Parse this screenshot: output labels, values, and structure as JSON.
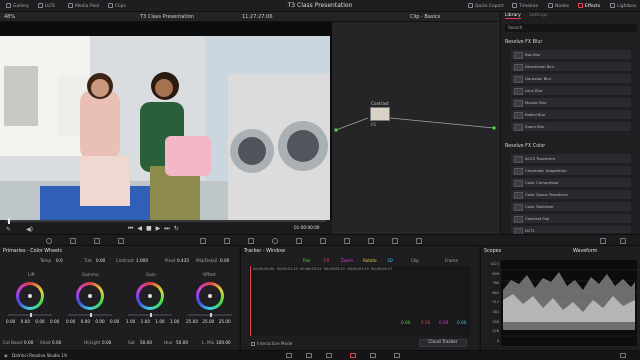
{
  "app": {
    "project_title": "T3 Class Presentation",
    "version": "DaVinci Resolve Studio 19"
  },
  "top_nav": {
    "left": [
      "Gallery",
      "LUTs",
      "Media Pool",
      "Clips"
    ],
    "right": [
      "Quick Export",
      "Timeline",
      "Nodes",
      "Effects",
      "Lightbox"
    ]
  },
  "viewer": {
    "zoom": "48%",
    "title": "T3 Class Presentation",
    "timecode": "11:27:27:06",
    "node_panel_title": "Clip - Basics",
    "playhead_timecode": "01:00:00:00"
  },
  "node_graph": {
    "node_label": "Contrast",
    "node_number": "01"
  },
  "library": {
    "tabs": [
      "Library",
      "Settings"
    ],
    "search_placeholder": "Search",
    "sections": [
      {
        "title": "Resolve FX Blur",
        "items": [
          "Box Blur",
          "Directional Blur",
          "Gaussian Blur",
          "Lens Blur",
          "Mosaic Blur",
          "Radial Blur",
          "Zoom Blur"
        ]
      },
      {
        "title": "Resolve FX Color",
        "items": [
          "ACES Transform",
          "Chromatic Adaptation",
          "Color Compressor",
          "Color Space Transform",
          "Color Stabilizer",
          "Contrast Pop",
          "DCTL"
        ]
      }
    ]
  },
  "color_wheels": {
    "title": "Primaries - Color Wheels",
    "temp_label": "Temp",
    "temp": "0.0",
    "tint_label": "Tint",
    "tint": "0.00",
    "contrast_label": "Contrast",
    "contrast": "1.000",
    "pivot_label": "Pivot",
    "pivot": "0.435",
    "middetail_label": "Mid/Detail",
    "middetail": "0.00",
    "wheels": [
      {
        "name": "Lift",
        "values": [
          "0.00",
          "0.00",
          "0.00",
          "0.00"
        ]
      },
      {
        "name": "Gamma",
        "values": [
          "0.00",
          "0.00",
          "0.00",
          "0.00"
        ]
      },
      {
        "name": "Gain",
        "values": [
          "1.00",
          "1.00",
          "1.00",
          "1.00"
        ]
      },
      {
        "name": "Offset",
        "values": [
          "25.00",
          "25.00",
          "25.00"
        ]
      }
    ],
    "bottom": [
      {
        "label": "Col Boost",
        "value": "0.00"
      },
      {
        "label": "Shad",
        "value": "0.00"
      },
      {
        "label": "Hi/Light",
        "value": "0.00"
      },
      {
        "label": "Sat",
        "value": "50.00"
      },
      {
        "label": "Hue",
        "value": "50.00"
      },
      {
        "label": "L. Mix",
        "value": "100.00"
      }
    ]
  },
  "tracker": {
    "title": "Tracker - Window",
    "modes": [
      "Pan",
      "Tilt",
      "Zoom",
      "Rotate",
      "3D"
    ],
    "clip_label": "Clip",
    "frame_label": "Frame",
    "timecodes": [
      "00:00:00:00",
      "00:00:01:23",
      "00:00:03:22",
      "00:00:05:21",
      "00:00:07:19",
      "00:00:09:17"
    ],
    "values": [
      "0.00",
      "0.00",
      "0.00",
      "0.00",
      "0.00"
    ],
    "interactive_mode": "Interactive Mode",
    "tracker_type": "Cloud Tracker"
  },
  "scopes": {
    "title": "Scopes",
    "type": "Waveform",
    "axis": [
      "1023",
      "896",
      "768",
      "640",
      "512",
      "384",
      "256",
      "128",
      "0"
    ]
  },
  "colors": {
    "accent": "#e0434d",
    "panel": "#1e1e21",
    "pan": "#4fd54a",
    "tilt": "#e04848",
    "zoom": "#e23fd6",
    "rotate": "#e0d040",
    "threed": "#4fb8e8"
  }
}
